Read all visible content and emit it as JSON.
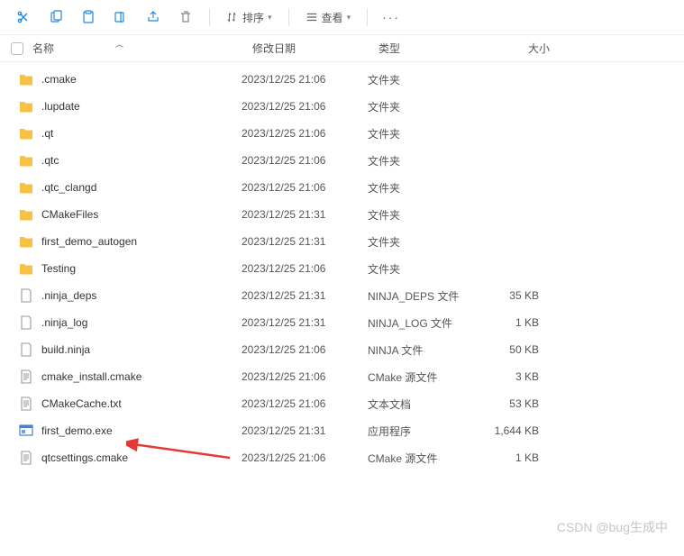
{
  "toolbar": {
    "sort_label": "排序",
    "view_label": "查看"
  },
  "columns": {
    "name": "名称",
    "date": "修改日期",
    "type": "类型",
    "size": "大小"
  },
  "files": [
    {
      "icon": "folder",
      "name": ".cmake",
      "date": "2023/12/25 21:06",
      "type": "文件夹",
      "size": ""
    },
    {
      "icon": "folder",
      "name": ".lupdate",
      "date": "2023/12/25 21:06",
      "type": "文件夹",
      "size": ""
    },
    {
      "icon": "folder",
      "name": ".qt",
      "date": "2023/12/25 21:06",
      "type": "文件夹",
      "size": ""
    },
    {
      "icon": "folder",
      "name": ".qtc",
      "date": "2023/12/25 21:06",
      "type": "文件夹",
      "size": ""
    },
    {
      "icon": "folder",
      "name": ".qtc_clangd",
      "date": "2023/12/25 21:06",
      "type": "文件夹",
      "size": ""
    },
    {
      "icon": "folder",
      "name": "CMakeFiles",
      "date": "2023/12/25 21:31",
      "type": "文件夹",
      "size": ""
    },
    {
      "icon": "folder",
      "name": "first_demo_autogen",
      "date": "2023/12/25 21:31",
      "type": "文件夹",
      "size": ""
    },
    {
      "icon": "folder",
      "name": "Testing",
      "date": "2023/12/25 21:06",
      "type": "文件夹",
      "size": ""
    },
    {
      "icon": "doc",
      "name": ".ninja_deps",
      "date": "2023/12/25 21:31",
      "type": "NINJA_DEPS 文件",
      "size": "35 KB"
    },
    {
      "icon": "doc",
      "name": ".ninja_log",
      "date": "2023/12/25 21:31",
      "type": "NINJA_LOG 文件",
      "size": "1 KB"
    },
    {
      "icon": "doc",
      "name": "build.ninja",
      "date": "2023/12/25 21:06",
      "type": "NINJA 文件",
      "size": "50 KB"
    },
    {
      "icon": "lines",
      "name": "cmake_install.cmake",
      "date": "2023/12/25 21:06",
      "type": "CMake 源文件",
      "size": "3 KB"
    },
    {
      "icon": "lines",
      "name": "CMakeCache.txt",
      "date": "2023/12/25 21:06",
      "type": "文本文档",
      "size": "53 KB"
    },
    {
      "icon": "exe",
      "name": "first_demo.exe",
      "date": "2023/12/25 21:31",
      "type": "应用程序",
      "size": "1,644 KB"
    },
    {
      "icon": "lines",
      "name": "qtcsettings.cmake",
      "date": "2023/12/25 21:06",
      "type": "CMake 源文件",
      "size": "1 KB"
    }
  ],
  "watermark": "CSDN @bug生成中"
}
